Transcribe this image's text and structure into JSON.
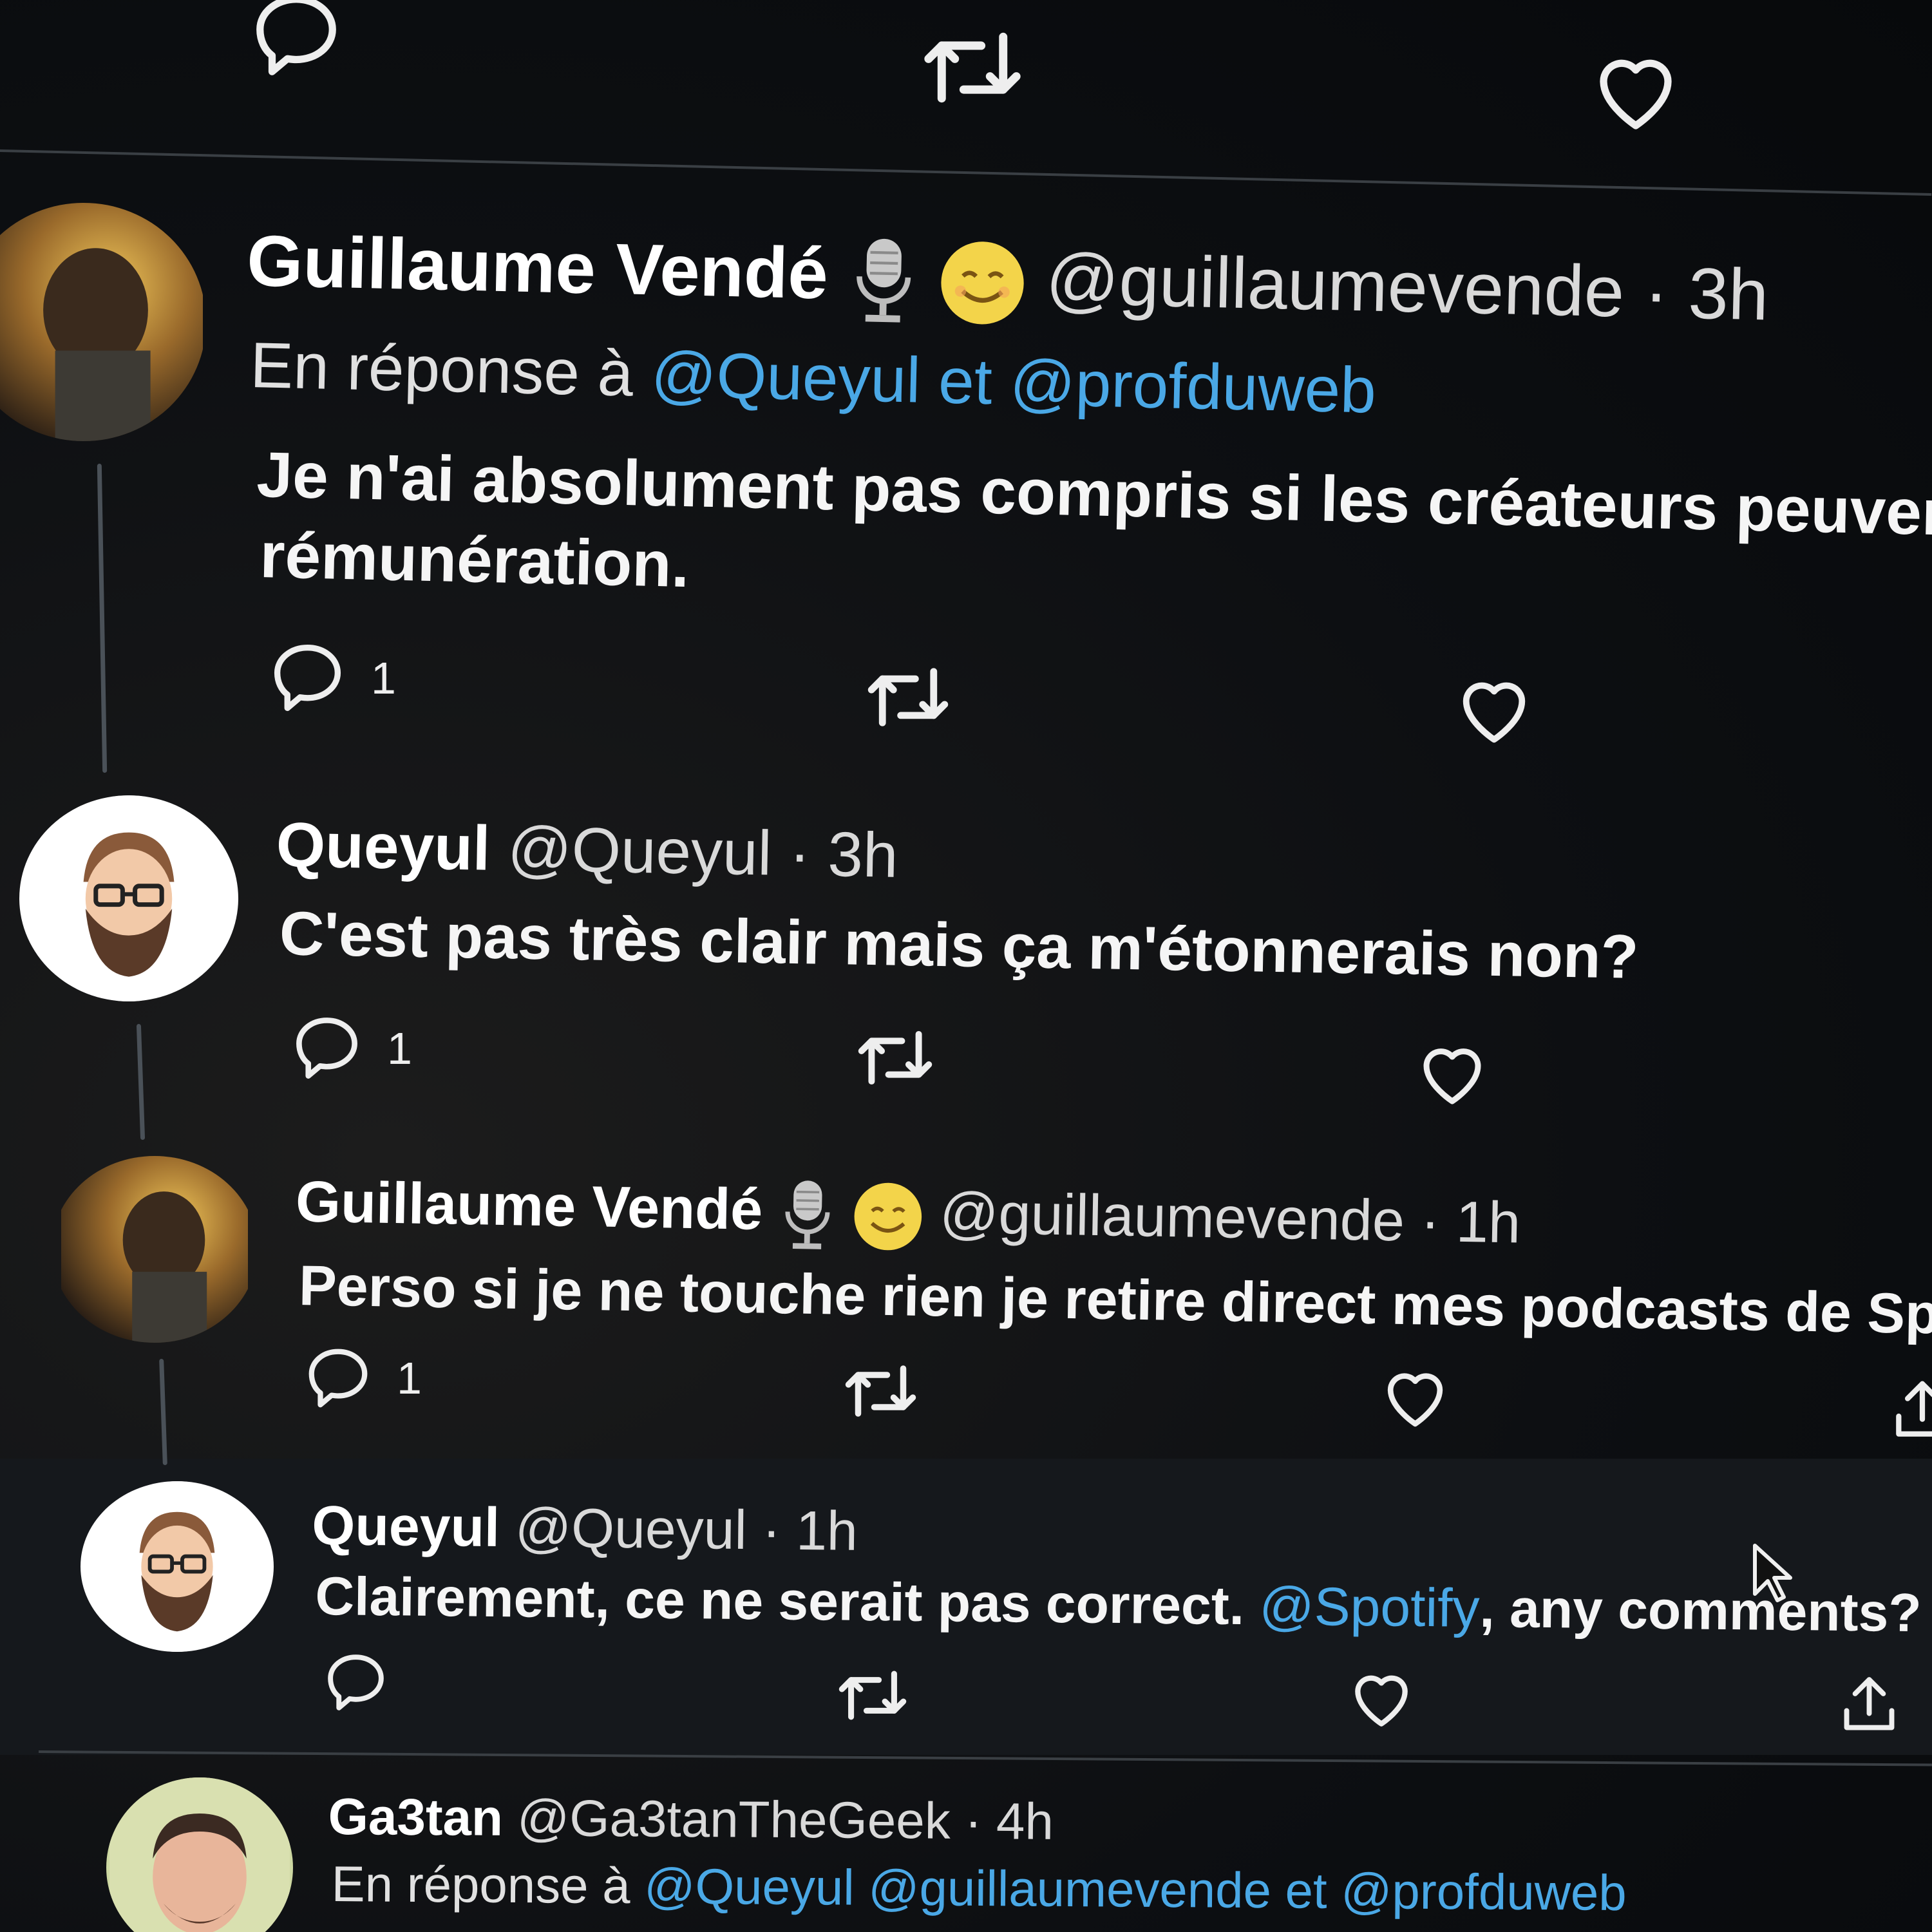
{
  "colors": {
    "background": "#0b0d10",
    "link": "#4aa8e6",
    "text": "#f5f5f5",
    "line": "#4a5158"
  },
  "tweets": [
    {
      "name": "Guillaume Vendé",
      "handle": "@guillaumevende",
      "time": "3h",
      "badges": [
        "microphone-emoji",
        "smiling-face-emoji"
      ],
      "reply_prefix": "En réponse à",
      "reply_to": [
        "@Queyul",
        "@profduweb"
      ],
      "reply_joiner": "et",
      "text_lines": [
        "Je n'ai absolument pas compris si les créateurs peuvent pr",
        "rémunération."
      ],
      "reply_count": "1"
    },
    {
      "name": "Queyul",
      "handle": "@Queyul",
      "time": "3h",
      "text_lines": [
        "C'est pas très clair mais ça m'étonnerais non?"
      ],
      "reply_count": "1"
    },
    {
      "name": "Guillaume Vendé",
      "handle": "@guillaumevende",
      "time": "1h",
      "badges": [
        "microphone-emoji",
        "smiling-face-emoji"
      ],
      "text_lines": [
        "Perso si je ne touche rien je retire direct mes podcasts de Spotif"
      ],
      "reply_count": "1"
    },
    {
      "name": "Queyul",
      "handle": "@Queyul",
      "time": "1h",
      "text_before": "Clairement, ce ne serait pas correct.",
      "mention": "@Spotify",
      "text_after": ", any comments?",
      "reply_count": ""
    },
    {
      "name": "Ga3tan",
      "handle": "@Ga3tanTheGeek",
      "time": "4h",
      "reply_prefix": "En réponse à",
      "reply_to": [
        "@Queyul",
        "@guillaumevende",
        "@profduweb"
      ],
      "reply_joiner": "et"
    }
  ],
  "separator": "·"
}
